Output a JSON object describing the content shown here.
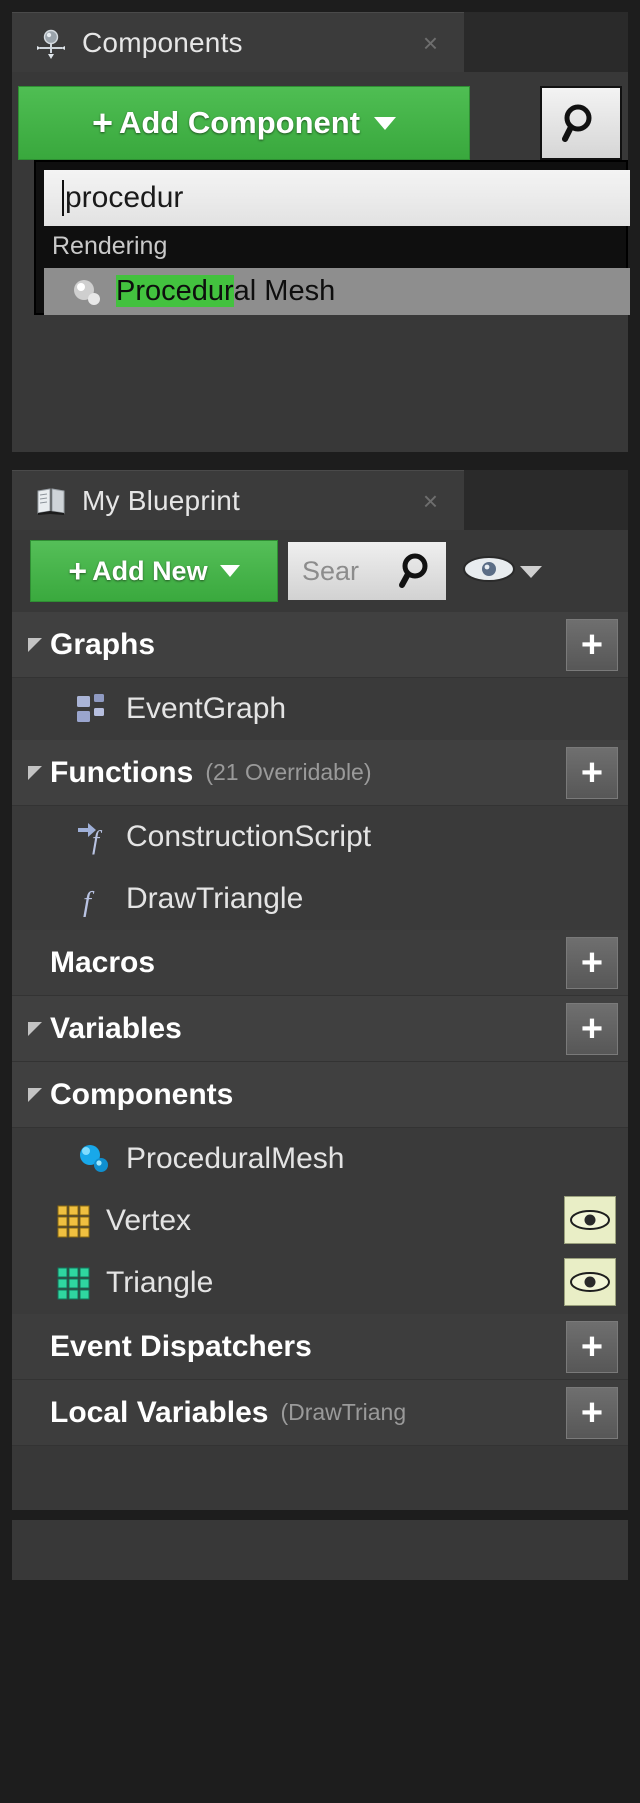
{
  "components_panel": {
    "tab_title": "Components",
    "tab_icon": "components-icon",
    "close_label": "×",
    "add_component": {
      "label": "Add Component",
      "plus": "+",
      "icon": "plus-icon"
    },
    "search_button_icon": "search-icon",
    "dropdown": {
      "query_value": "procedur",
      "category": "Rendering",
      "result": {
        "highlight": "Procedur",
        "rest": "al Mesh",
        "icon": "procedural-mesh-icon"
      }
    }
  },
  "myblueprint_panel": {
    "tab_title": "My Blueprint",
    "tab_icon": "blueprint-book-icon",
    "close_label": "×",
    "toolbar": {
      "add_new_label": "Add New",
      "plus": "+",
      "search_placeholder": "Sear",
      "search_icon": "search-icon",
      "eye_icon": "eye-icon",
      "eye_caret_icon": "chevron-down-icon"
    },
    "sections": [
      {
        "id": "graphs",
        "label": "Graphs",
        "sub": "",
        "expandable": true,
        "add_button": "+",
        "items": [
          {
            "label": "EventGraph",
            "icon": "event-graph-icon",
            "indent": "sub",
            "eye": false
          }
        ]
      },
      {
        "id": "functions",
        "label": "Functions",
        "sub": "(21 Overridable)",
        "expandable": true,
        "add_button": "+",
        "items": [
          {
            "label": "ConstructionScript",
            "icon": "construction-script-icon",
            "indent": "sub",
            "eye": false
          },
          {
            "label": "DrawTriangle",
            "icon": "function-icon",
            "indent": "sub",
            "eye": false
          }
        ]
      },
      {
        "id": "macros",
        "label": "Macros",
        "sub": "",
        "expandable": false,
        "add_button": "+",
        "items": []
      },
      {
        "id": "variables",
        "label": "Variables",
        "sub": "",
        "expandable": true,
        "add_button": "+",
        "items": []
      },
      {
        "id": "components",
        "label": "Components",
        "sub": "",
        "expandable": true,
        "add_button": "",
        "items": [
          {
            "label": "ProceduralMesh",
            "icon": "procedural-mesh-icon",
            "indent": "sub",
            "eye": false
          },
          {
            "label": "Vertex",
            "icon": "array-variable-yellow-icon",
            "indent": "normal",
            "eye": true
          },
          {
            "label": "Triangle",
            "icon": "array-variable-teal-icon",
            "indent": "normal",
            "eye": true
          }
        ]
      },
      {
        "id": "event-dispatchers",
        "label": "Event Dispatchers",
        "sub": "",
        "expandable": false,
        "add_button": "+",
        "items": []
      },
      {
        "id": "local-variables",
        "label": "Local Variables",
        "sub": "(DrawTriang",
        "expandable": false,
        "add_button": "+",
        "items": []
      }
    ]
  },
  "colors": {
    "accent_green": "#4fbe53",
    "highlight_green": "#43c23f",
    "panel_bg": "#383838",
    "section_bg": "#404040",
    "vertex_yellow": "#f0c040",
    "triangle_teal": "#2fd6a0",
    "mesh_blue": "#17a9e8"
  }
}
